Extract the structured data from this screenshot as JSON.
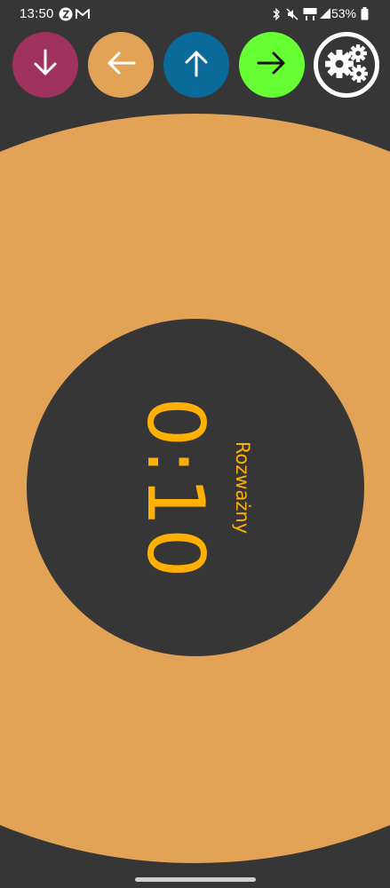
{
  "status_bar": {
    "time": "13:50",
    "battery_percent": "53%"
  },
  "toolbar": {
    "buttons": [
      {
        "id": "down",
        "icon": "arrow-down-icon",
        "color": "#a0325f"
      },
      {
        "id": "left",
        "icon": "arrow-left-icon",
        "color": "#e2a356"
      },
      {
        "id": "up",
        "icon": "arrow-up-icon",
        "color": "#0a6b9a"
      },
      {
        "id": "right",
        "icon": "arrow-right-icon",
        "color": "#66ff33"
      },
      {
        "id": "settings",
        "icon": "gears-icon",
        "color": "#363636"
      }
    ]
  },
  "timer": {
    "value": "0:10",
    "mode_label": "Rozważny",
    "text_color": "#ffb000",
    "ring_color": "#e2a356",
    "background_color": "#363636"
  }
}
